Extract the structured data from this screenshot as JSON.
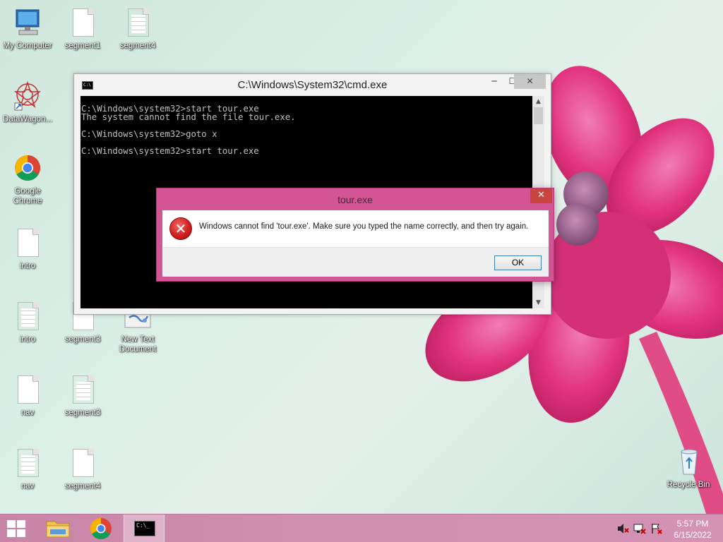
{
  "desktop": {
    "icons": [
      {
        "label": "My Computer"
      },
      {
        "label": "segment1"
      },
      {
        "label": "segment4"
      },
      {
        "label": "DataWagon..."
      },
      {
        "label": "Google Chrome"
      },
      {
        "label": "intro"
      },
      {
        "label": "intro"
      },
      {
        "label": "segment3"
      },
      {
        "label": "New Text Document"
      },
      {
        "label": "nav"
      },
      {
        "label": "segment3"
      },
      {
        "label": "nav"
      },
      {
        "label": "segment4"
      },
      {
        "label": "Recycle Bin"
      }
    ],
    "partial_label": "se"
  },
  "cmd_window": {
    "title": "C:\\Windows\\System32\\cmd.exe",
    "icon_text": "C:\\",
    "buttons": {
      "minimize": "─",
      "maximize": "☐",
      "close": "✕"
    },
    "console_text": "C:\\Windows\\system32>start tour.exe\nThe system cannot find the file tour.exe.\n\nC:\\Windows\\system32>goto x\n\nC:\\Windows\\system32>start tour.exe"
  },
  "dialog": {
    "title": "tour.exe",
    "close": "✕",
    "icon": "error-icon",
    "message": "Windows cannot find 'tour.exe'. Make sure you typed the name correctly, and then try again.",
    "ok_label": "OK"
  },
  "taskbar": {
    "items": [
      "start-button",
      "file-explorer",
      "google-chrome",
      "command-prompt"
    ],
    "cmd_icon_text": "C:\\_",
    "clock": {
      "time": "5:57 PM",
      "date": "6/15/2022"
    }
  },
  "colors": {
    "dialog_frame": "#d45594",
    "taskbar": "#cf8fb0",
    "console_bg": "#000000",
    "console_fg": "#c0c0c0"
  }
}
